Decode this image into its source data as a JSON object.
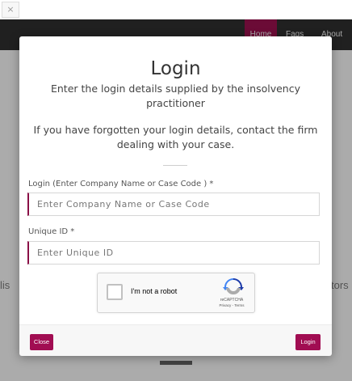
{
  "browser": {
    "tab_close_glyph": "×"
  },
  "page": {
    "nav": {
      "home": "Home",
      "faqs": "Faqs",
      "about": "About"
    },
    "peek_left": "lis",
    "peek_right": "tors"
  },
  "modal": {
    "title": "Login",
    "subtitle": "Enter the login details supplied by the insolvency practitioner",
    "help": "If you have forgotten your login details, contact the firm dealing with your case.",
    "login_field": {
      "label": "Login (Enter Company Name or Case Code ) *",
      "placeholder": "Enter Company Name or Case Code",
      "value": ""
    },
    "uid_field": {
      "label": "Unique ID *",
      "placeholder": "Enter Unique ID",
      "value": ""
    },
    "recaptcha": {
      "label": "I'm not a robot",
      "brand": "reCAPTCHA",
      "links": "Privacy - Terms",
      "checked": false
    },
    "footer": {
      "close_label": "Close",
      "login_label": "Login"
    }
  },
  "colors": {
    "accent": "#a10d52",
    "nav_bg": "#2a2a2a",
    "nav_active": "#8a0f46"
  }
}
